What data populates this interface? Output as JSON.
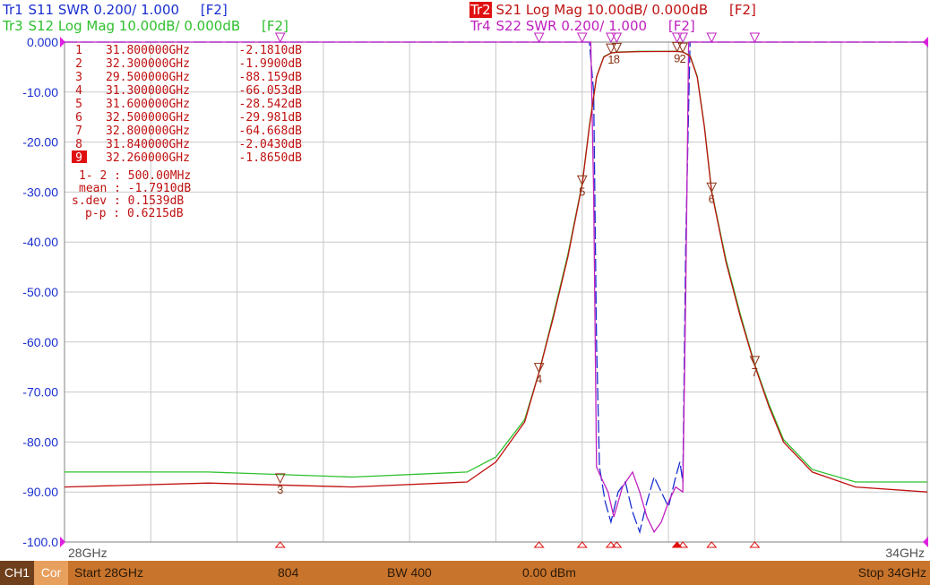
{
  "traces": [
    {
      "name": "Tr1",
      "param": "S11",
      "desc": "SWR 0.200/ 1.000",
      "key": "[F2]",
      "color": "#1a2fd0",
      "active": false
    },
    {
      "name": "Tr2",
      "param": "S21",
      "desc": "Log Mag 10.00dB/ 0.000dB",
      "key": "[F2]",
      "color": "#c01010",
      "active": true
    },
    {
      "name": "Tr3",
      "param": "S12",
      "desc": "Log Mag 10.00dB/ 0.000dB",
      "key": "[F2]",
      "color": "#2ec02e",
      "active": false
    },
    {
      "name": "Tr4",
      "param": "S22",
      "desc": "SWR 0.200/ 1.000",
      "key": "[F2]",
      "color": "#c020c0",
      "active": false
    }
  ],
  "marker_table": [
    {
      "num": "1",
      "freq": "31.800000GHz",
      "val": "-2.1810dB"
    },
    {
      "num": "2",
      "freq": "32.300000GHz",
      "val": "-1.9900dB"
    },
    {
      "num": "3",
      "freq": "29.500000GHz",
      "val": "-88.159dB"
    },
    {
      "num": "4",
      "freq": "31.300000GHz",
      "val": "-66.053dB"
    },
    {
      "num": "5",
      "freq": "31.600000GHz",
      "val": "-28.542dB"
    },
    {
      "num": "6",
      "freq": "32.500000GHz",
      "val": "-29.981dB"
    },
    {
      "num": "7",
      "freq": "32.800000GHz",
      "val": "-64.668dB"
    },
    {
      "num": "8",
      "freq": "31.840000GHz",
      "val": "-2.0430dB"
    },
    {
      "num": "9",
      "freq": "32.260000GHz",
      "val": "-1.8650dB",
      "active": true
    }
  ],
  "stats": [
    "1- 2 : 500.00MHz",
    "mean : -1.7910dB",
    "s.dev : 0.1539dB",
    "p-p : 0.6215dB"
  ],
  "status": {
    "channel": "CH1",
    "cor": "Cor",
    "start": "Start 28GHz",
    "points": "804",
    "bw": "BW 400",
    "power": "0.00 dBm",
    "stop": "Stop 34GHz"
  },
  "chart_data": {
    "type": "line",
    "xlim": [
      28,
      34
    ],
    "ylim": [
      -100,
      0
    ],
    "x_tick_labels": [
      "28GHz",
      "34GHz"
    ],
    "y_tick_labels": [
      "0.000",
      "-10.00",
      "-20.00",
      "-30.00",
      "-40.00",
      "-50.00",
      "-60.00",
      "-70.00",
      "-80.00",
      "-90.00",
      "-100.0"
    ],
    "grid": true,
    "series": [
      {
        "name": "S21",
        "color": "#c01010",
        "x": [
          28.0,
          29.0,
          30.0,
          30.8,
          31.0,
          31.2,
          31.3,
          31.4,
          31.5,
          31.6,
          31.65,
          31.7,
          31.75,
          31.8,
          31.84,
          32.0,
          32.26,
          32.3,
          32.35,
          32.4,
          32.45,
          32.5,
          32.6,
          32.7,
          32.8,
          32.9,
          33.0,
          33.2,
          33.5,
          34.0
        ],
        "y": [
          -89,
          -88.2,
          -89,
          -88,
          -84,
          -76,
          -66,
          -55,
          -43,
          -28.5,
          -17,
          -7,
          -3,
          -2.18,
          -2.04,
          -1.9,
          -1.87,
          -1.99,
          -2.8,
          -7,
          -17,
          -30,
          -44,
          -55,
          -64.7,
          -73,
          -80,
          -86,
          -89,
          -90
        ]
      },
      {
        "name": "S12",
        "color": "#2ec02e",
        "x": [
          28.0,
          29.0,
          30.0,
          30.8,
          31.0,
          31.2,
          31.3,
          31.4,
          31.5,
          31.6,
          31.65,
          31.7,
          31.75,
          31.8,
          31.84,
          32.0,
          32.26,
          32.3,
          32.35,
          32.4,
          32.45,
          32.5,
          32.6,
          32.7,
          32.8,
          32.9,
          33.0,
          33.2,
          33.5,
          34.0
        ],
        "y": [
          -86,
          -86,
          -87,
          -86,
          -83,
          -75.5,
          -66,
          -54.5,
          -42.5,
          -28.3,
          -16.8,
          -6.9,
          -2.9,
          -2.15,
          -2.0,
          -1.85,
          -1.84,
          -1.95,
          -2.7,
          -6.8,
          -16.8,
          -29.8,
          -43.5,
          -54.5,
          -64.5,
          -72.5,
          -79.5,
          -85.5,
          -88,
          -88
        ]
      },
      {
        "name": "S11",
        "color": "#1a2fd0",
        "x": [
          28.0,
          31.65,
          31.68,
          31.7,
          31.72,
          31.76,
          31.8,
          31.85,
          31.9,
          31.95,
          32.0,
          32.05,
          32.1,
          32.15,
          32.2,
          32.25,
          32.28,
          32.3,
          32.32,
          32.35,
          34.0
        ],
        "y": [
          0,
          0,
          -10,
          -60,
          -85,
          -92,
          -96,
          -90,
          -88,
          -94,
          -98,
          -92,
          -87,
          -90,
          -93,
          -87,
          -84,
          -88,
          -40,
          0,
          0
        ]
      },
      {
        "name": "S22",
        "color": "#c020c0",
        "x": [
          28.0,
          31.66,
          31.68,
          31.7,
          31.73,
          31.78,
          31.82,
          31.88,
          31.95,
          32.0,
          32.05,
          32.1,
          32.15,
          32.2,
          32.25,
          32.3,
          32.32,
          32.34,
          34.0
        ],
        "y": [
          0,
          0,
          -30,
          -85,
          -87,
          -90,
          -95,
          -89,
          -86,
          -90,
          -95,
          -98,
          -96,
          -92,
          -89,
          -90,
          -50,
          0,
          0
        ]
      }
    ],
    "markers": [
      {
        "label": "1",
        "x": 31.8,
        "y": -2.181
      },
      {
        "label": "2",
        "x": 32.3,
        "y": -1.99
      },
      {
        "label": "3",
        "x": 29.5,
        "y": -88.159
      },
      {
        "label": "4",
        "x": 31.3,
        "y": -66.053
      },
      {
        "label": "5",
        "x": 31.6,
        "y": -28.542
      },
      {
        "label": "6",
        "x": 32.5,
        "y": -29.981
      },
      {
        "label": "7",
        "x": 32.8,
        "y": -64.668
      },
      {
        "label": "8",
        "x": 31.84,
        "y": -2.043
      },
      {
        "label": "9",
        "x": 32.26,
        "y": -1.865
      }
    ]
  }
}
